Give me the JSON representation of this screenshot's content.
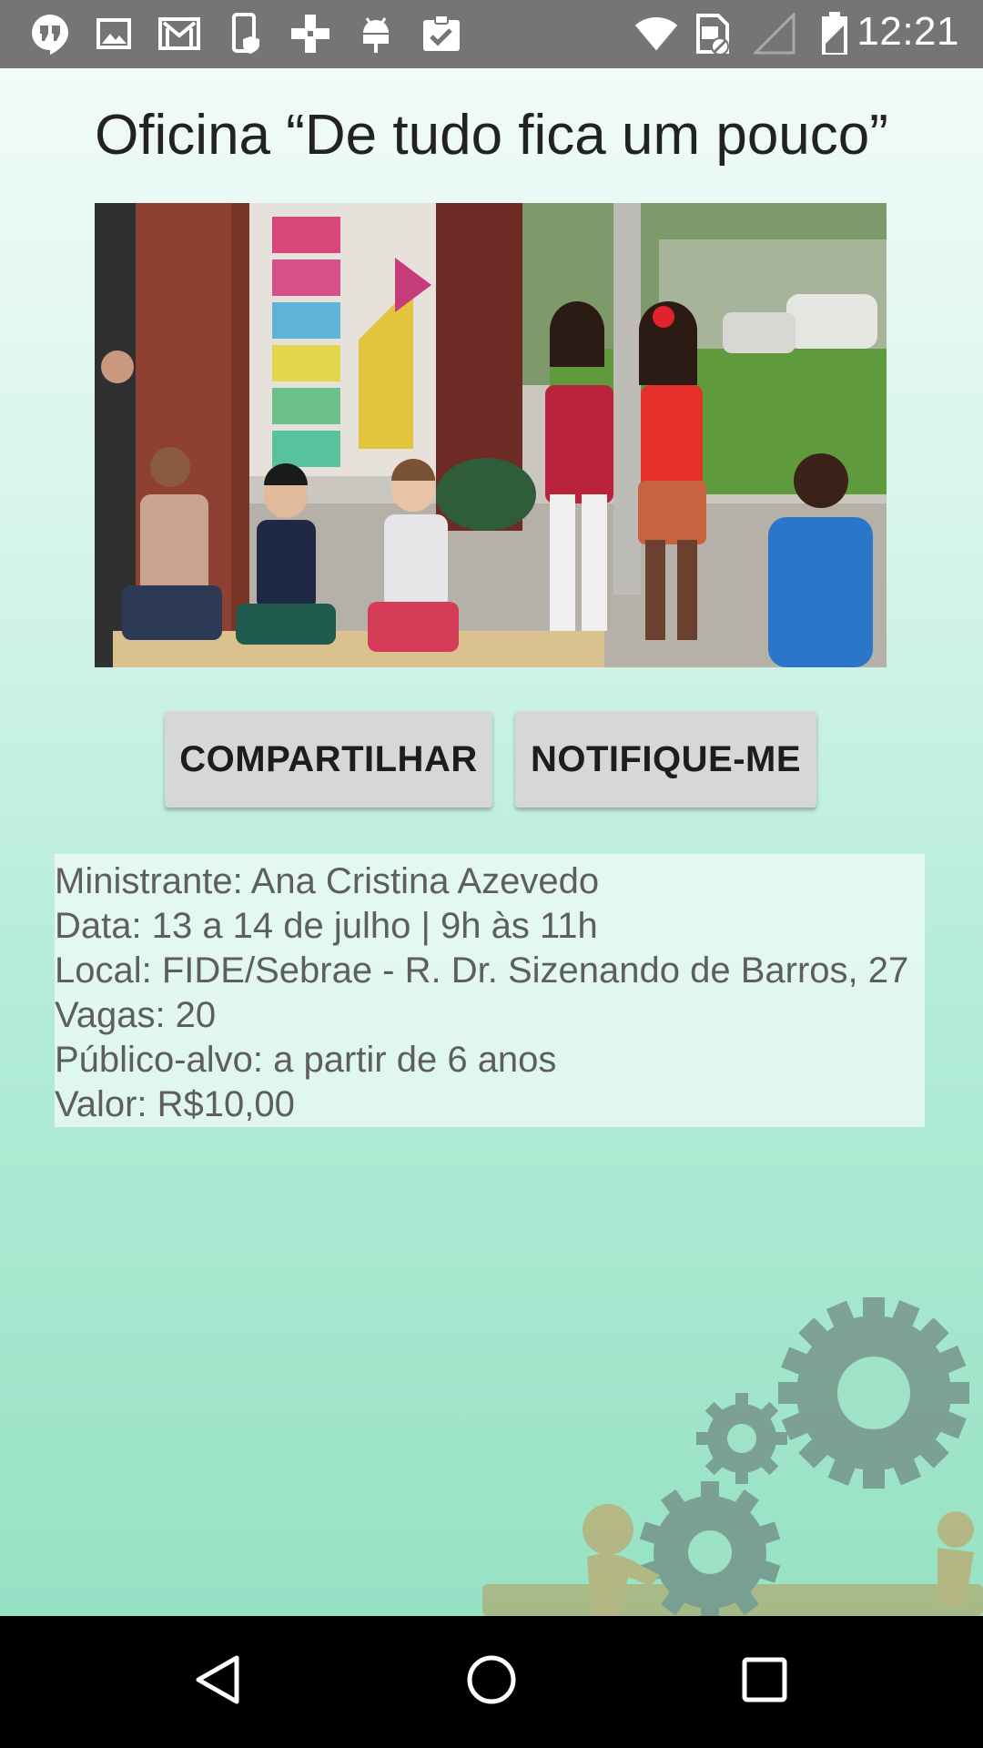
{
  "status_bar": {
    "time": "12:21",
    "icons": [
      "hangouts-icon",
      "image-icon",
      "gmail-icon",
      "phone-shield-icon",
      "plus-icon",
      "android-icon",
      "clipboard-check-icon",
      "wifi-icon",
      "sim-icon",
      "signal-icon",
      "battery-icon"
    ]
  },
  "header": {
    "title": "Oficina “De tudo fica um pouco”"
  },
  "photo": {
    "description_icon": "workshop-photo"
  },
  "actions": {
    "share_label": "COMPARTILHAR",
    "notify_label": "NOTIFIQUE-ME"
  },
  "details": {
    "instructor": "Ministrante: Ana Cristina Azevedo",
    "date": "Data: 13 a 14 de julho | 9h às 11h",
    "location": "Local: FIDE/Sebrae - R. Dr. Sizenando de Barros, 27",
    "slots": "Vagas: 20",
    "audience": "Público-alvo: a partir de 6 anos",
    "price": "Valor: R$10,00"
  },
  "colors": {
    "status_bar": "#757575",
    "background_top": "#f2fbf7",
    "background_bottom": "#96e2c5",
    "button": "#d6d7d7",
    "nav_bar": "#000000"
  }
}
